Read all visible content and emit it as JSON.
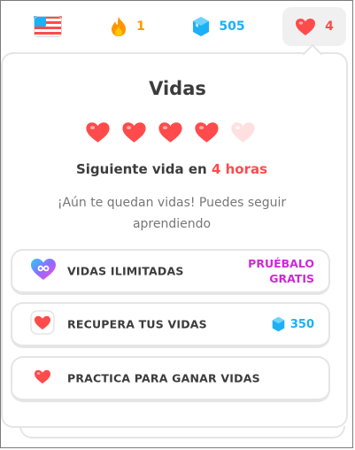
{
  "topbar": {
    "language_icon": "us-flag-icon",
    "streak_count": "1",
    "gems_count": "505",
    "hearts_count": "4"
  },
  "colors": {
    "heart": "#ff4b4b",
    "heart_empty": "#ffe0e0",
    "streak": "#ff9600",
    "gems": "#1cb0f6",
    "promo": "#ce28d8",
    "text": "#3c3c3c",
    "muted": "#777777"
  },
  "lives_panel": {
    "title": "Vidas",
    "hearts_full": 4,
    "hearts_total": 5,
    "next_life_prefix": "Siguiente vida en ",
    "next_life_time": "4 horas",
    "message": "¡Aún te quedan vidas! Puedes seguir aprendiendo"
  },
  "options": [
    {
      "label": "VIDAS ILIMITADAS",
      "action_line1": "PRUÉBALO",
      "action_line2": "GRATIS",
      "icon": "infinity-heart-icon"
    },
    {
      "label": "RECUPERA TUS VIDAS",
      "cost": "350",
      "icon": "heart-icon"
    },
    {
      "label": "PRACTICA PARA GANAR VIDAS",
      "icon": "heart-icon"
    }
  ]
}
